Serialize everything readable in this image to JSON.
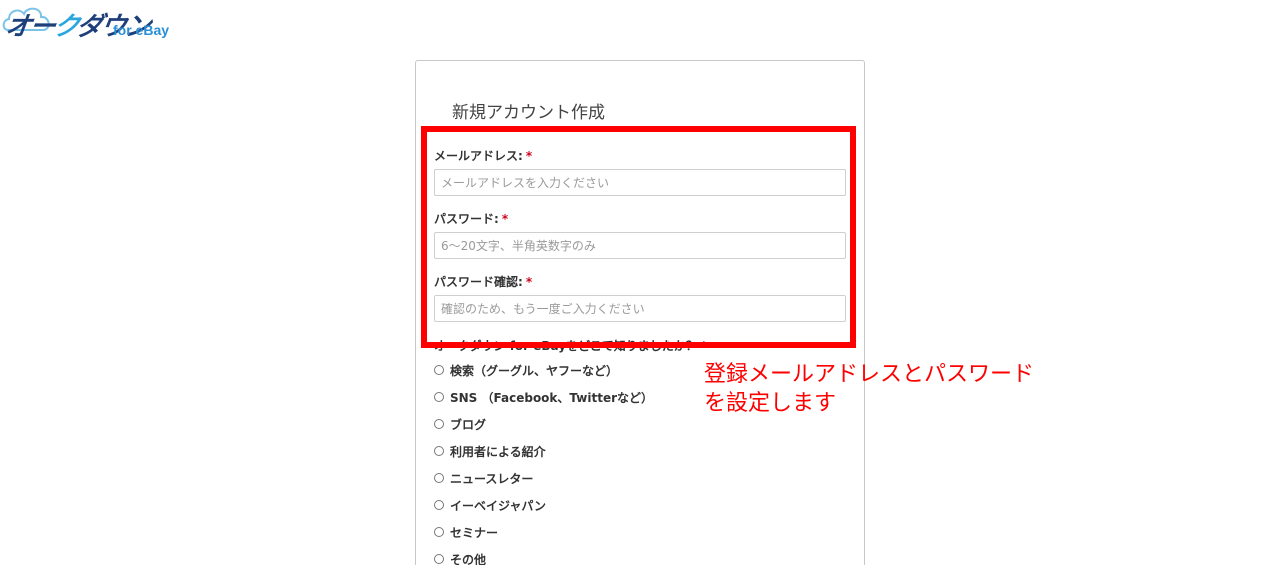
{
  "logo": {
    "main_a": "オー",
    "dash": "ク",
    "main_b": "ダウン",
    "sub": "for eBay"
  },
  "form": {
    "title": "新規アカウント作成",
    "email": {
      "label": "メールアドレス:",
      "required": "*",
      "placeholder": "メールアドレスを入力ください"
    },
    "password": {
      "label": "パスワード:",
      "required": "*",
      "placeholder": "6〜20文字、半角英数字のみ"
    },
    "password_confirm": {
      "label": "パスワード確認:",
      "required": "*",
      "placeholder": "確認のため、もう一度ご入力ください"
    },
    "source_question": {
      "label": "オークダウン for eBayをどこで知りましたか？",
      "required": "*"
    },
    "options": [
      "検索（グーグル、ヤフーなど）",
      "SNS （Facebook、Twitterなど）",
      "ブログ",
      "利用者による紹介",
      "ニュースレター",
      "イーベイジャパン",
      "セミナー",
      "その他"
    ]
  },
  "annotation": {
    "line1": "登録メールアドレスとパスワード",
    "line2": "を設定します"
  },
  "colors": {
    "highlight": "#ff0000",
    "required": "#d0021b",
    "logo_navy": "#1f3f7a",
    "logo_blue": "#2a8fd6"
  }
}
